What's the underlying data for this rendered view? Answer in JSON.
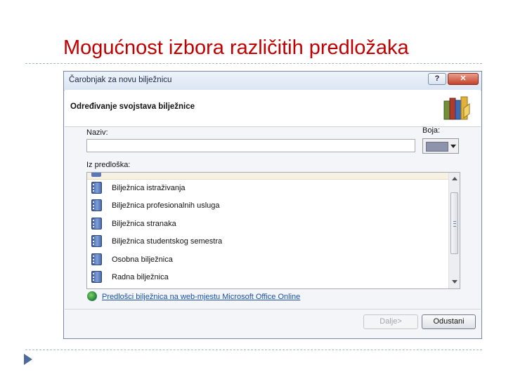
{
  "slide": {
    "title": "Mogućnost izbora različitih predložaka"
  },
  "dialog": {
    "title": "Čarobnjak za novu bilježnicu",
    "help_label": "?",
    "close_label": "✕",
    "header": "Određivanje svojstava bilježnice",
    "name_label": "Naziv:",
    "name_value": "",
    "color_label": "Boja:",
    "color_value": "#8d93ab",
    "template_label": "Iz predloška:",
    "templates": [
      "Bilježnica istraživanja",
      "Bilježnica profesionalnih usluga",
      "Bilježnica stranaka",
      "Bilježnica studentskog semestra",
      "Osobna bilježnica",
      "Radna bilježnica"
    ],
    "online_link": "Predlošci bilježnica na web-mjestu Microsoft Office Online",
    "next_label": "Dalje>",
    "cancel_label": "Odustani"
  }
}
